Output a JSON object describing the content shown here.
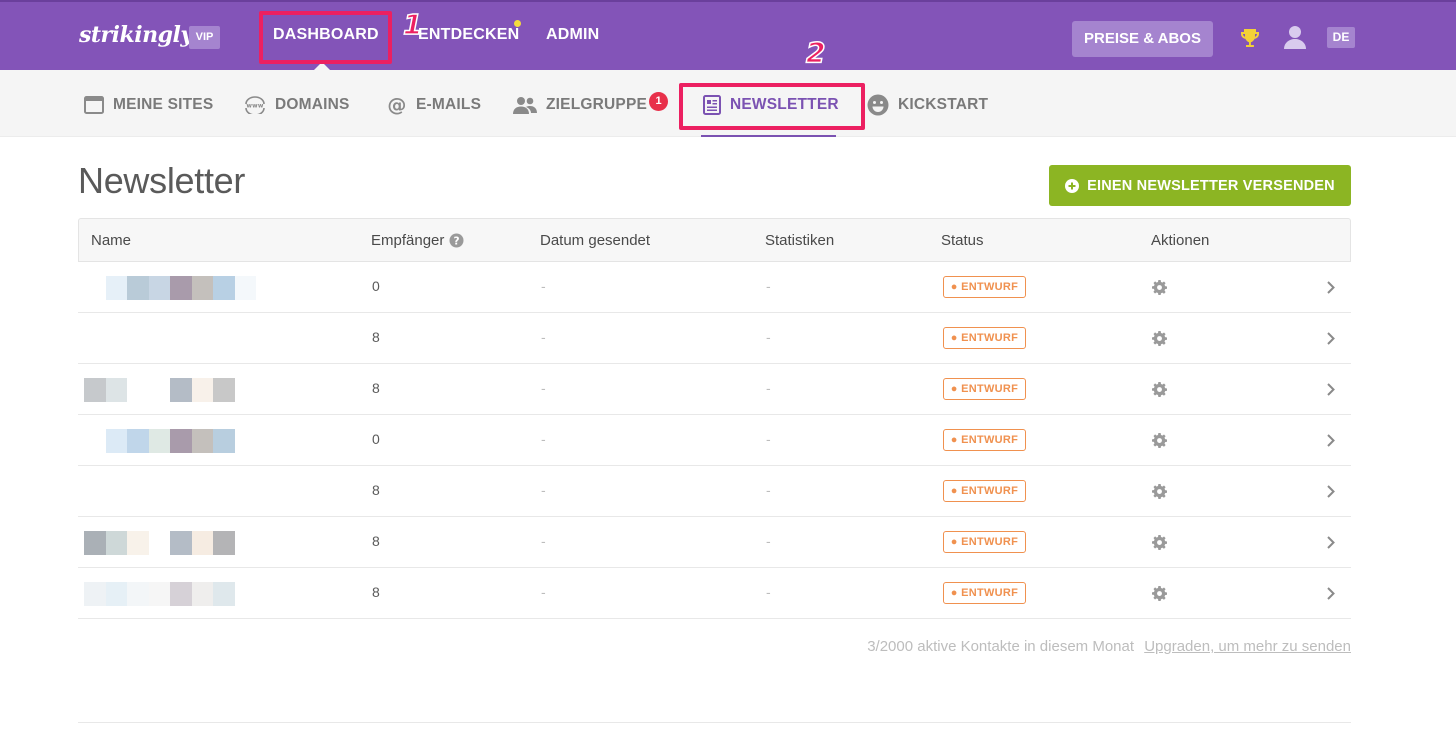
{
  "topbar": {
    "logo": "strikingly",
    "vip_label": "VIP",
    "nav": [
      {
        "label": "DASHBOARD"
      },
      {
        "label": "ENTDECKEN"
      },
      {
        "label": "ADMIN"
      }
    ],
    "pricing_label": "PREISE & ABOS",
    "language": "DE"
  },
  "subnav": {
    "items": [
      {
        "label": "MEINE SITES"
      },
      {
        "label": "DOMAINS"
      },
      {
        "label": "E-MAILS"
      },
      {
        "label": "ZIELGRUPPE"
      },
      {
        "label": "NEWSLETTER"
      },
      {
        "label": "KICKSTART"
      }
    ],
    "zielgruppe_badge": "1"
  },
  "annotations": {
    "one": "1",
    "two": "2"
  },
  "page": {
    "title": "Newsletter",
    "send_button": "EINEN NEWSLETTER VERSENDEN"
  },
  "table": {
    "columns": [
      "Name",
      "Empfänger",
      "Datum gesendet",
      "Statistiken",
      "Status",
      "Aktionen"
    ],
    "rows": [
      {
        "recipients": "0",
        "date": "-",
        "stats": "-",
        "status": "ENTWURF"
      },
      {
        "recipients": "8",
        "date": "-",
        "stats": "-",
        "status": "ENTWURF"
      },
      {
        "recipients": "8",
        "date": "-",
        "stats": "-",
        "status": "ENTWURF"
      },
      {
        "recipients": "0",
        "date": "-",
        "stats": "-",
        "status": "ENTWURF"
      },
      {
        "recipients": "8",
        "date": "-",
        "stats": "-",
        "status": "ENTWURF"
      },
      {
        "recipients": "8",
        "date": "-",
        "stats": "-",
        "status": "ENTWURF"
      },
      {
        "recipients": "8",
        "date": "-",
        "stats": "-",
        "status": "ENTWURF"
      }
    ]
  },
  "footer": {
    "contacts_text": "3/2000 aktive Kontakte in diesem Monat",
    "upgrade_link": "Upgraden, um mehr zu senden"
  },
  "colors": {
    "brand_purple": "#8354b8",
    "accent_green": "#8cb523",
    "draft_orange": "#f0914f",
    "annotation_pink": "#ec2061"
  }
}
